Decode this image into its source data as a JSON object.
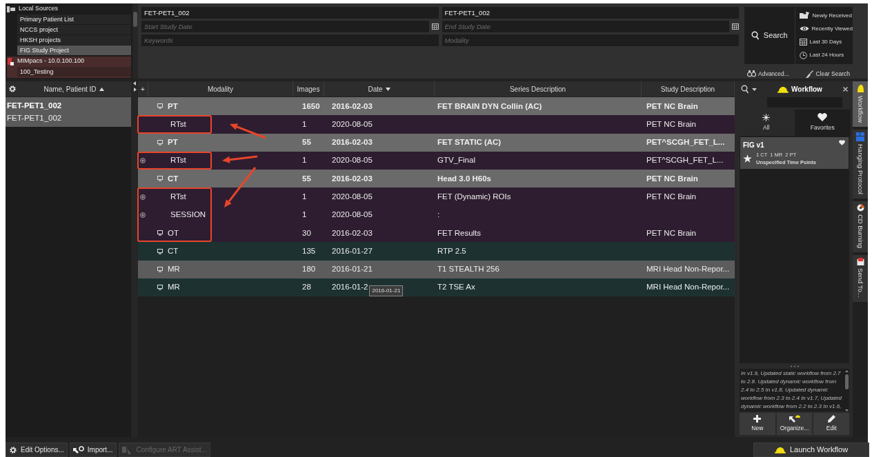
{
  "sources": [
    {
      "label": "Local Sources",
      "kind": "local",
      "selected": false,
      "children": [
        {
          "label": "Primary Patient List",
          "selected": false
        },
        {
          "label": "NCCS project",
          "selected": false
        },
        {
          "label": "HKSH projects",
          "selected": false
        },
        {
          "label": "FIG Study Project",
          "selected": true
        }
      ]
    },
    {
      "label": "MIMpacs - 10.0.100.100",
      "kind": "remote",
      "selected": false,
      "children": [
        {
          "label": "100_Testing",
          "selected": false
        }
      ]
    }
  ],
  "search": {
    "fields": [
      {
        "kind": "text",
        "value": "FET-PET1_002"
      },
      {
        "kind": "text",
        "value": "FET-PET1_002"
      },
      {
        "kind": "date",
        "placeholder": "Start Study Date"
      },
      {
        "kind": "date",
        "placeholder": "End Study Date"
      },
      {
        "kind": "text",
        "placeholder": "Keywords"
      },
      {
        "kind": "text",
        "placeholder": "Modality"
      }
    ],
    "search_button": "Search",
    "quick_filters": [
      "Newly Received",
      "Recently Viewed",
      "Last 30 Days",
      "Last 24 Hours"
    ],
    "advanced": "Advanced...",
    "clear": "Clear Search"
  },
  "patients": {
    "header": "Name, Patient ID",
    "sorted_ascending": true,
    "entries": [
      {
        "name": "FET-PET1_002",
        "patient_id": "FET-PET1_002",
        "selected": true
      }
    ]
  },
  "series_table": {
    "columns": [
      {
        "label": "+"
      },
      {
        "label": "Modality"
      },
      {
        "label": "Images"
      },
      {
        "label": "Date",
        "sorted_descending": true
      },
      {
        "label": "Series Description"
      },
      {
        "label": "Study Description"
      }
    ],
    "rows": [
      {
        "modality": "PT",
        "images": "1650",
        "date": "2016-02-03",
        "series_description": "FET BRAIN DYN Collin (AC)",
        "study_description": "PET NC Brain",
        "kind": "series",
        "expandable": false,
        "bold": true,
        "color": "#6a6a6a",
        "annotated": false
      },
      {
        "modality": "RTst",
        "images": "1",
        "date": "2020-08-05",
        "series_description": "",
        "study_description": "PET NC Brain",
        "kind": "object",
        "expandable": false,
        "bold": false,
        "color": "#2e1d30",
        "annotated": true
      },
      {
        "modality": "PT",
        "images": "55",
        "date": "2016-02-03",
        "series_description": "FET STATIC (AC)",
        "study_description": "PET^SCGH_FET_L...",
        "kind": "series",
        "expandable": false,
        "bold": true,
        "color": "#6a6a6a",
        "annotated": false
      },
      {
        "modality": "RTst",
        "images": "1",
        "date": "2020-08-05",
        "series_description": "GTV_Final",
        "study_description": "PET^SCGH_FET_L...",
        "kind": "object",
        "expandable": true,
        "bold": false,
        "color": "#2e1d30",
        "annotated": true
      },
      {
        "modality": "CT",
        "images": "55",
        "date": "2016-02-03",
        "series_description": "Head  3.0  H60s",
        "study_description": "PET NC Brain",
        "kind": "series",
        "expandable": false,
        "bold": true,
        "color": "#6a6a6a",
        "annotated": false
      },
      {
        "modality": "RTst",
        "images": "1",
        "date": "2020-08-05",
        "series_description": "FET (Dynamic) ROIs",
        "study_description": "PET NC Brain",
        "kind": "object",
        "expandable": true,
        "bold": false,
        "color": "#2e1d30",
        "annotated": true
      },
      {
        "modality": "SESSION",
        "images": "1",
        "date": "2020-08-05",
        "series_description": ":",
        "study_description": "",
        "kind": "object",
        "expandable": true,
        "bold": false,
        "color": "#2e1d30",
        "annotated": true
      },
      {
        "modality": "OT",
        "images": "30",
        "date": "2016-02-03",
        "series_description": "FET Results",
        "study_description": "PET NC Brain",
        "kind": "series",
        "expandable": false,
        "bold": false,
        "color": "#2e1d30",
        "annotated": true
      },
      {
        "modality": "CT",
        "images": "135",
        "date": "2016-01-27",
        "series_description": "RTP 2.5",
        "study_description": "",
        "kind": "series",
        "expandable": false,
        "bold": false,
        "color": "#1d3131",
        "annotated": false
      },
      {
        "modality": "MR",
        "images": "180",
        "date": "2016-01-21",
        "series_description": "T1 STEALTH 256",
        "study_description": "MRI Head Non-Repor...",
        "kind": "series",
        "expandable": false,
        "bold": false,
        "color": "#5c5c5c",
        "annotated": false
      },
      {
        "modality": "MR",
        "images": "28",
        "date": "2016-01-2",
        "series_description": "T2 TSE Ax",
        "study_description": "MRI Head Non-Repor...",
        "kind": "series",
        "expandable": false,
        "bold": false,
        "color": "#1d3131",
        "annotated": false
      }
    ],
    "tooltip": "2016-01-21"
  },
  "workflow_panel": {
    "title": "Workflow",
    "tabs": [
      {
        "label": "All",
        "selected": false
      },
      {
        "label": "Favorites",
        "selected": true
      }
    ],
    "workflows": [
      {
        "name": "FIG v1",
        "favorite": true,
        "counts": "1 CT  1 MR  2 PT",
        "time_points": "Unspecified Time Points"
      }
    ],
    "description": "In v1.9, Updated static workflow from 2.7 to 2.8. Updated dynamic workflow from 2.4 to 2.5 In v1.8, Updated dynamic workflow from 2.3 to 2.4 In v1.7, Updated dynamic workflow from 2.2 to 2.3 In v1.6,",
    "buttons": [
      "New",
      "Organize...",
      "Edit"
    ]
  },
  "side_tabs": [
    {
      "label": "Workflow",
      "selected": true
    },
    {
      "label": "Hanging Protocol",
      "selected": false
    },
    {
      "label": "CD Burning",
      "selected": false
    },
    {
      "label": "Send To...",
      "selected": false
    }
  ],
  "toolbar": [
    {
      "label": "Edit Options...",
      "disabled": false
    },
    {
      "label": "Import...",
      "disabled": false
    },
    {
      "label": "Configure ART Assist...",
      "disabled": true
    }
  ],
  "launch_button": "Launch Workflow"
}
